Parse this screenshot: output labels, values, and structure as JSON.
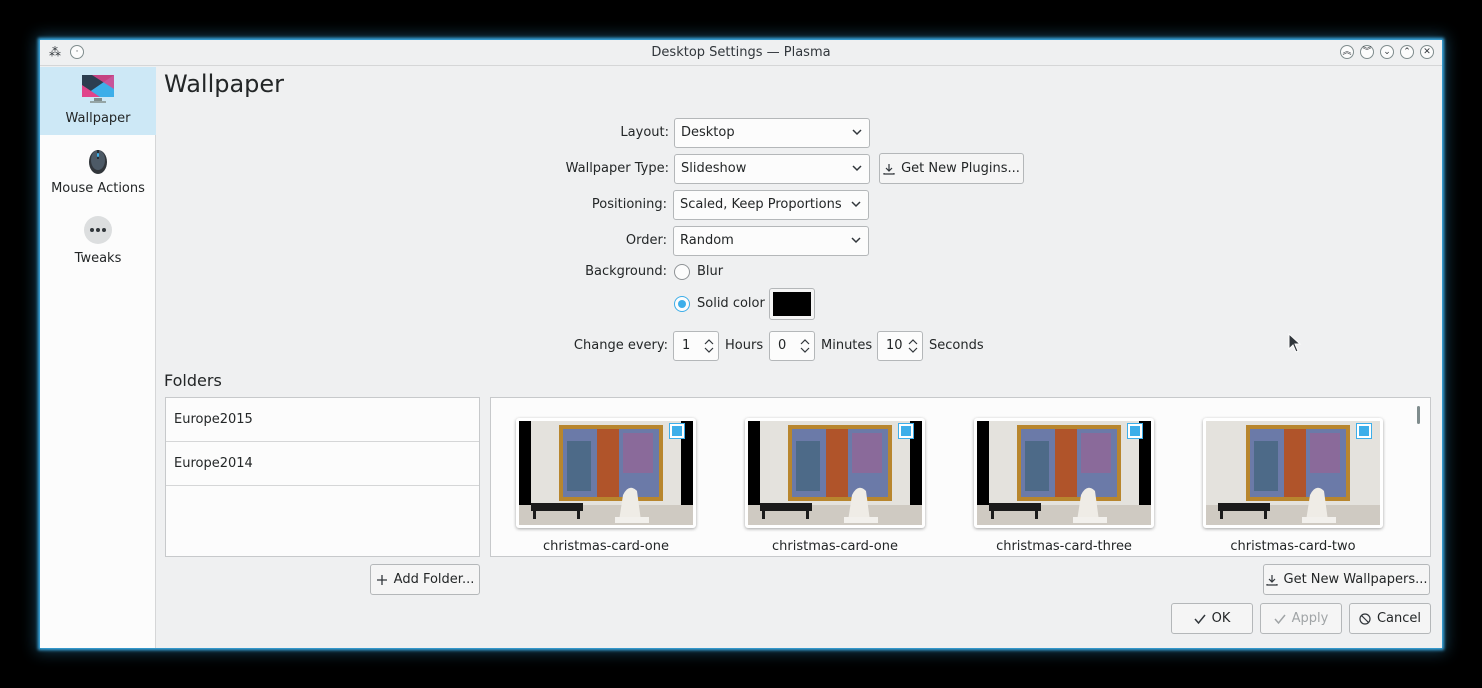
{
  "window": {
    "title": "Desktop Settings — Plasma"
  },
  "sidebar": {
    "items": [
      {
        "label": "Wallpaper",
        "icon": "monitor-icon",
        "active": true
      },
      {
        "label": "Mouse Actions",
        "icon": "mouse-icon",
        "active": false
      },
      {
        "label": "Tweaks",
        "icon": "more-icon",
        "active": false
      }
    ]
  },
  "page": {
    "title": "Wallpaper"
  },
  "form": {
    "layout_label": "Layout:",
    "layout_value": "Desktop",
    "wallpaper_type_label": "Wallpaper Type:",
    "wallpaper_type_value": "Slideshow",
    "get_plugins_label": "Get New Plugins...",
    "positioning_label": "Positioning:",
    "positioning_value": "Scaled, Keep Proportions",
    "order_label": "Order:",
    "order_value": "Random",
    "background_label": "Background:",
    "blur_label": "Blur",
    "solid_color_label": "Solid color",
    "solid_color_value": "#000000",
    "change_every_label": "Change every:",
    "hours_value": "1",
    "hours_label": "Hours",
    "minutes_value": "0",
    "minutes_label": "Minutes",
    "seconds_value": "10",
    "seconds_label": "Seconds"
  },
  "folders": {
    "title": "Folders",
    "items": [
      "Europe2015",
      "Europe2014"
    ],
    "add_folder_label": "Add Folder..."
  },
  "wallpapers": {
    "items": [
      {
        "name": "christmas-card-one",
        "checked": true
      },
      {
        "name": "christmas-card-one",
        "checked": true
      },
      {
        "name": "christmas-card-three",
        "checked": true
      },
      {
        "name": "christmas-card-two",
        "checked": true
      }
    ],
    "get_new_label": "Get New Wallpapers..."
  },
  "footer": {
    "ok_label": "OK",
    "apply_label": "Apply",
    "cancel_label": "Cancel"
  },
  "colors": {
    "accent": "#3daee9",
    "selected_bg": "#cde8f6"
  }
}
